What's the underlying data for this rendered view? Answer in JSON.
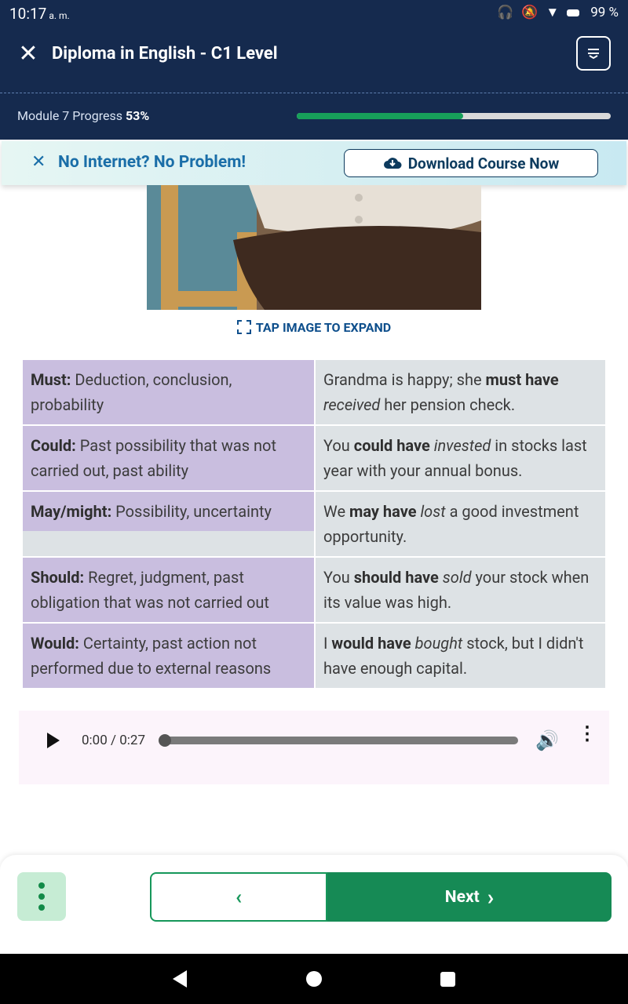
{
  "status": {
    "time": "10:17",
    "ampm": "a. m.",
    "battery": "99 %"
  },
  "header": {
    "title": "Diploma in English - C1 Level"
  },
  "progress": {
    "label": "Module 7 Progress",
    "percent_text": "53%",
    "value": 0.53
  },
  "banner": {
    "text": "No Internet? No Problem!",
    "button_label": "Download Course Now"
  },
  "image": {
    "expand_label": "TAP IMAGE TO EXPAND"
  },
  "table": {
    "rows": [
      {
        "modal": "Must:",
        "meaning": " Deduction, conclusion, probability",
        "ex_pre": "Grandma is happy; she ",
        "ex_bold": "must have",
        "ex_italic": "received",
        "ex_post": " her pension check."
      },
      {
        "modal": "Could:",
        "meaning": " Past possibility that was not carried out, past ability",
        "ex_pre": "You ",
        "ex_bold": "could have",
        "ex_italic": "invested",
        "ex_post": " in stocks last year with your annual bonus."
      },
      {
        "modal": "May/might:",
        "meaning": " Possibility, uncertainty",
        "ex_pre": "We ",
        "ex_bold": "may have",
        "ex_italic": "lost",
        "ex_post": " a good investment opportunity."
      },
      {
        "modal": "Should:",
        "meaning": " Regret, judgment, past obligation that was not carried out",
        "ex_pre": "You ",
        "ex_bold": "should have",
        "ex_italic": "sold",
        "ex_post": " your stock when its value was high."
      },
      {
        "modal": "Would:",
        "meaning": " Certainty, past action not performed due to external reasons",
        "ex_pre": "I ",
        "ex_bold": "would have",
        "ex_italic": "bought",
        "ex_post": " stock, but I didn't have enough capital."
      }
    ]
  },
  "audio": {
    "time": "0:00 / 0:27",
    "progress": 0
  },
  "footer": {
    "next_label": "Next"
  }
}
